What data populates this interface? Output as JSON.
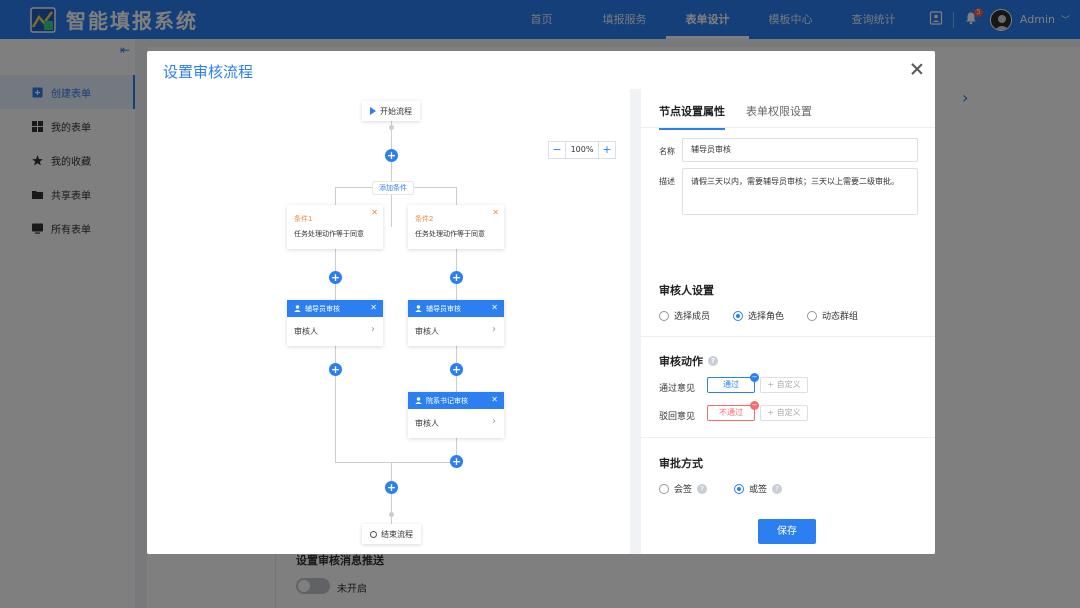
{
  "header": {
    "app_title": "智能填报系统",
    "nav": [
      "首页",
      "填报服务",
      "表单设计",
      "模板中心",
      "查询统计"
    ],
    "active_nav": 2,
    "notification_count": "5",
    "username": "Admin"
  },
  "sidebar": {
    "items": [
      {
        "label": "创建表单",
        "icon": "create-form-icon",
        "active": true
      },
      {
        "label": "我的表单",
        "icon": "grid-icon",
        "active": false
      },
      {
        "label": "我的收藏",
        "icon": "star-icon",
        "active": false
      },
      {
        "label": "共享表单",
        "icon": "share-folder-icon",
        "active": false
      },
      {
        "label": "所有表单",
        "icon": "monitor-icon",
        "active": false
      }
    ]
  },
  "background": {
    "section_label": "设置审核消息推送",
    "switch_label": "未开启"
  },
  "modal": {
    "title": "设置审核流程",
    "flow": {
      "start_label": "开始流程",
      "end_label": "结束流程",
      "add_condition": "添加条件",
      "zoom": "100%",
      "conditions": [
        {
          "title": "条件1",
          "desc": "任务处理动作等于同意"
        },
        {
          "title": "条件2",
          "desc": "任务处理动作等于同意"
        }
      ],
      "approvers": [
        {
          "title": "辅导员审核",
          "body": "审核人"
        },
        {
          "title": "辅导员审核",
          "body": "审核人"
        },
        {
          "title": "院系书记审核",
          "body": "审核人"
        }
      ]
    },
    "panel": {
      "tabs": [
        "节点设置属性",
        "表单权限设置"
      ],
      "name_label": "名称",
      "name_value": "辅导员审核",
      "desc_label": "描述",
      "desc_value": "请假三天以内，需要辅导员审核；三天以上需要二级审批。",
      "reviewer_title": "审核人设置",
      "reviewer_options": [
        "选择成员",
        "选择角色",
        "动态群组"
      ],
      "reviewer_selected": 1,
      "action_title": "审核动作",
      "pass_label": "通过意见",
      "pass_tag": "通过",
      "reject_label": "驳回意见",
      "reject_tag": "不通过",
      "custom_tag": "+ 自定义",
      "method_title": "审批方式",
      "method_options": [
        "会签",
        "或签"
      ],
      "method_selected": 1,
      "save": "保存"
    }
  }
}
